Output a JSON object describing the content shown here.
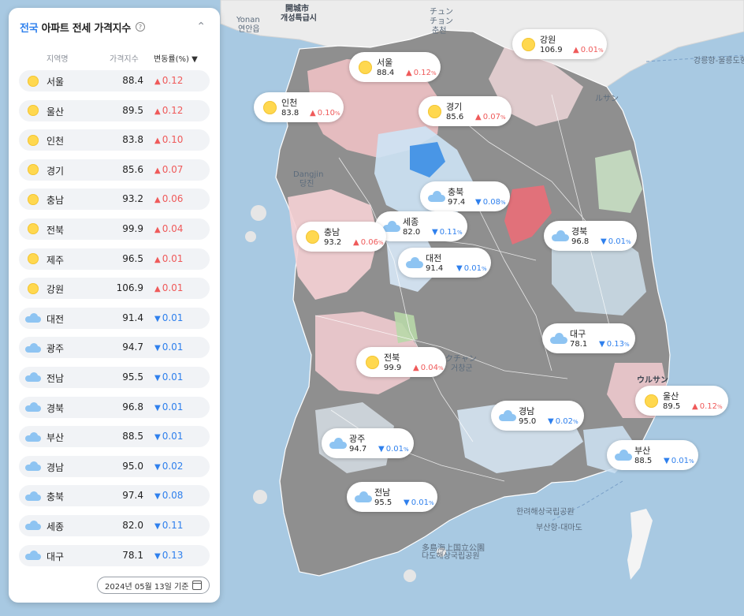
{
  "panel": {
    "title_accent": "전국",
    "title_rest": "아파트 전세 가격지수",
    "col_region": "지역명",
    "col_price": "가격지수",
    "col_change": "변동률(%) ▼",
    "date": "2024년 05월 13일 기준",
    "rows": [
      {
        "name": "서울",
        "price": "88.4",
        "change": "0.12",
        "dir": "up",
        "weather": "sun"
      },
      {
        "name": "울산",
        "price": "89.5",
        "change": "0.12",
        "dir": "up",
        "weather": "sun"
      },
      {
        "name": "인천",
        "price": "83.8",
        "change": "0.10",
        "dir": "up",
        "weather": "sun"
      },
      {
        "name": "경기",
        "price": "85.6",
        "change": "0.07",
        "dir": "up",
        "weather": "sun"
      },
      {
        "name": "충남",
        "price": "93.2",
        "change": "0.06",
        "dir": "up",
        "weather": "sun"
      },
      {
        "name": "전북",
        "price": "99.9",
        "change": "0.04",
        "dir": "up",
        "weather": "sun"
      },
      {
        "name": "제주",
        "price": "96.5",
        "change": "0.01",
        "dir": "up",
        "weather": "sun"
      },
      {
        "name": "강원",
        "price": "106.9",
        "change": "0.01",
        "dir": "up",
        "weather": "sun"
      },
      {
        "name": "대전",
        "price": "91.4",
        "change": "0.01",
        "dir": "down",
        "weather": "cloud"
      },
      {
        "name": "광주",
        "price": "94.7",
        "change": "0.01",
        "dir": "down",
        "weather": "cloud"
      },
      {
        "name": "전남",
        "price": "95.5",
        "change": "0.01",
        "dir": "down",
        "weather": "cloud"
      },
      {
        "name": "경북",
        "price": "96.8",
        "change": "0.01",
        "dir": "down",
        "weather": "cloud"
      },
      {
        "name": "부산",
        "price": "88.5",
        "change": "0.01",
        "dir": "down",
        "weather": "cloud"
      },
      {
        "name": "경남",
        "price": "95.0",
        "change": "0.02",
        "dir": "down",
        "weather": "cloud"
      },
      {
        "name": "충북",
        "price": "97.4",
        "change": "0.08",
        "dir": "down",
        "weather": "cloud"
      },
      {
        "name": "세종",
        "price": "82.0",
        "change": "0.11",
        "dir": "down",
        "weather": "cloud"
      },
      {
        "name": "대구",
        "price": "78.1",
        "change": "0.13",
        "dir": "down",
        "weather": "cloud"
      }
    ]
  },
  "bubbles": [
    {
      "name": "강원",
      "price": "106.9",
      "change": "0.01",
      "dir": "up",
      "weather": "sun"
    },
    {
      "name": "서울",
      "price": "88.4",
      "change": "0.12",
      "dir": "up",
      "weather": "sun"
    },
    {
      "name": "인천",
      "price": "83.8",
      "change": "0.10",
      "dir": "up",
      "weather": "sun"
    },
    {
      "name": "경기",
      "price": "85.6",
      "change": "0.07",
      "dir": "up",
      "weather": "sun"
    },
    {
      "name": "충북",
      "price": "97.4",
      "change": "0.08",
      "dir": "down",
      "weather": "cloud"
    },
    {
      "name": "세종",
      "price": "82.0",
      "change": "0.11",
      "dir": "down",
      "weather": "cloud"
    },
    {
      "name": "충남",
      "price": "93.2",
      "change": "0.06",
      "dir": "up",
      "weather": "sun"
    },
    {
      "name": "경북",
      "price": "96.8",
      "change": "0.01",
      "dir": "down",
      "weather": "cloud"
    },
    {
      "name": "대전",
      "price": "91.4",
      "change": "0.01",
      "dir": "down",
      "weather": "cloud"
    },
    {
      "name": "대구",
      "price": "78.1",
      "change": "0.13",
      "dir": "down",
      "weather": "cloud"
    },
    {
      "name": "전북",
      "price": "99.9",
      "change": "0.04",
      "dir": "up",
      "weather": "sun"
    },
    {
      "name": "울산",
      "price": "89.5",
      "change": "0.12",
      "dir": "up",
      "weather": "sun"
    },
    {
      "name": "경남",
      "price": "95.0",
      "change": "0.02",
      "dir": "down",
      "weather": "cloud"
    },
    {
      "name": "광주",
      "price": "94.7",
      "change": "0.01",
      "dir": "down",
      "weather": "cloud"
    },
    {
      "name": "부산",
      "price": "88.5",
      "change": "0.01",
      "dir": "down",
      "weather": "cloud"
    },
    {
      "name": "전남",
      "price": "95.5",
      "change": "0.01",
      "dir": "down",
      "weather": "cloud"
    }
  ],
  "map_labels": [
    {
      "text": "Yonan"
    },
    {
      "text": "연안읍"
    },
    {
      "text": "開城市"
    },
    {
      "text": "개성특급시"
    },
    {
      "text": "チュン"
    },
    {
      "text": "チョン"
    },
    {
      "text": "춘천"
    },
    {
      "text": "강릉항-울릉도항"
    },
    {
      "text": "ルサン"
    },
    {
      "text": "Dangjin"
    },
    {
      "text": "당진"
    },
    {
      "text": "クチャン"
    },
    {
      "text": "거창군"
    },
    {
      "text": "ウルサン"
    },
    {
      "text": "한려해상국립공원"
    },
    {
      "text": "부산항-대마도"
    },
    {
      "text": "多島海上国立公園"
    },
    {
      "text": "다도해상국립공원"
    }
  ],
  "colors": {
    "accent": "#2f80ed",
    "up": "#ef5a5a",
    "down": "#2f80ed",
    "sea": "#a8c9e2",
    "sun": "#ffd84f",
    "cloud": "#8ec4f2"
  }
}
